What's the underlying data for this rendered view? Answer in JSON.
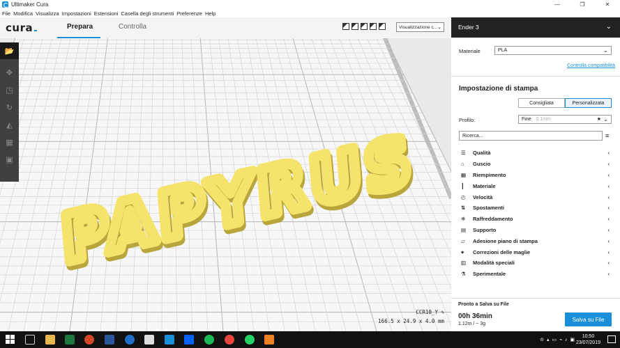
{
  "window": {
    "title": "Ultimaker Cura",
    "minimize": "—",
    "maximize": "❐",
    "close": "✕"
  },
  "menu": [
    "File",
    "Modifica",
    "Visualizza",
    "Impostazioni",
    "Estensioni",
    "Casella degli strumenti",
    "Preferenze",
    "Help"
  ],
  "header": {
    "logo": "cura",
    "tabs": [
      {
        "label": "Prepara",
        "active": true
      },
      {
        "label": "Controlla",
        "active": false
      }
    ],
    "view_mode": "Visualizzazione c...",
    "view_chevron": "⌄"
  },
  "model": {
    "name": "CCR10_Y",
    "dimensions": "166.5 x 24.9 x 4.0 mm",
    "text": "PAPYRUS",
    "color": "#f6e36b",
    "shadow": "#b8a53c"
  },
  "panel": {
    "printer": "Ender 3",
    "material_label": "Materiale",
    "material_value": "PLA",
    "compat_link": "Controlla compatibilità",
    "print_setup_title": "Impostazione di stampa",
    "mode_buttons": [
      {
        "label": "Consigliata",
        "active": false
      },
      {
        "label": "Personalizzata",
        "active": true
      }
    ],
    "profile_label": "Profilo:",
    "profile_value": "Fine",
    "profile_hint": "0.1mm",
    "search_placeholder": "Ricerca...",
    "categories": [
      {
        "label": "Qualità",
        "icon": "quality-icon"
      },
      {
        "label": "Guscio",
        "icon": "shell-icon"
      },
      {
        "label": "Riempimento",
        "icon": "infill-icon"
      },
      {
        "label": "Materiale",
        "icon": "material-icon"
      },
      {
        "label": "Velocità",
        "icon": "speed-icon"
      },
      {
        "label": "Spostamenti",
        "icon": "travel-icon"
      },
      {
        "label": "Raffreddamento",
        "icon": "cooling-icon"
      },
      {
        "label": "Supporto",
        "icon": "support-icon"
      },
      {
        "label": "Adesione piano di stampa",
        "icon": "adhesion-icon"
      },
      {
        "label": "Correzioni delle maglie",
        "icon": "mesh-fix-icon"
      },
      {
        "label": "Modalità speciali",
        "icon": "special-modes-icon"
      },
      {
        "label": "Sperimentale",
        "icon": "experimental-icon"
      }
    ],
    "status": "Pronto a Salva su File",
    "print_time": "00h 36min",
    "usage": "1.12m / ~ 3g",
    "save_button": "Salva su File"
  },
  "taskbar": {
    "time": "10:50",
    "date": "23/07/2019"
  },
  "colors": {
    "accent": "#1a8fd8",
    "dark": "#222222",
    "toolbar": "#404040"
  }
}
